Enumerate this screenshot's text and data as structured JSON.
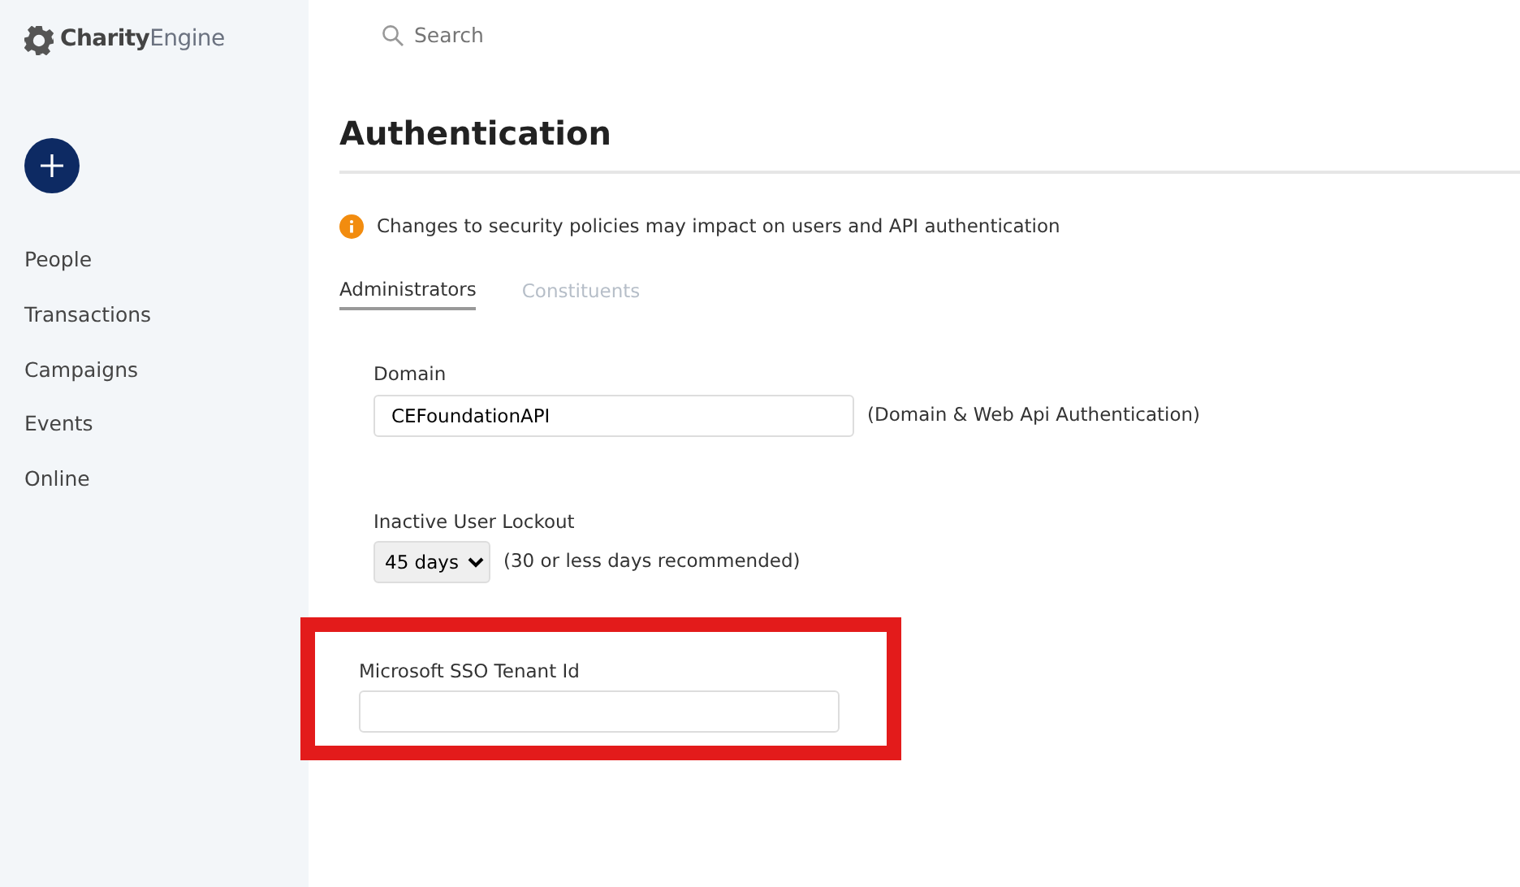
{
  "sidebar": {
    "logo": "**Charity**Engine",
    "items": [
      {
        "label": "People"
      },
      {
        "label": "Transactions"
      },
      {
        "label": "Campaigns"
      },
      {
        "label": "Events"
      },
      {
        "label": "Online"
      }
    ]
  },
  "search": {
    "placeholder": "Search"
  },
  "title": "Authentication",
  "notice": "Changes to security policies may impact on users and API authentication",
  "tabs": [
    {
      "label": "Administrators",
      "selected": true
    },
    {
      "label": "Constituents",
      "selected": false
    }
  ],
  "fields": [
    {
      "kind": "text",
      "label": "Domain",
      "value": "CEFoundationAPI",
      "hint": "(Domain & Web Api Authentication)",
      "highlighted": false
    },
    {
      "kind": "select",
      "label": "Inactive User Lockout",
      "value": "45 days",
      "hint": "(30 or less days recommended)",
      "highlighted": false
    },
    {
      "kind": "text",
      "label": "Microsoft SSO Tenant Id",
      "highlighted": true
    }
  ]
}
